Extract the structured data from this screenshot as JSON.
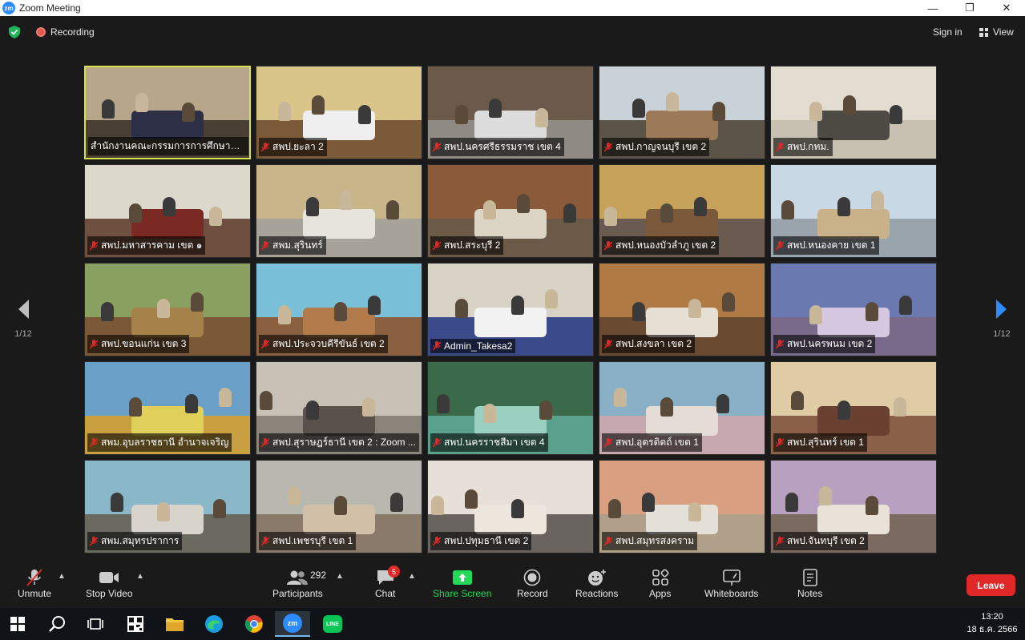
{
  "window": {
    "title": "Zoom Meeting",
    "logo_text": "zm",
    "minimize": "—",
    "restore": "❐",
    "close": "✕"
  },
  "top": {
    "recording_label": "Recording",
    "signin_label": "Sign in",
    "view_label": "View"
  },
  "pagination": {
    "left_page": "1/12",
    "right_page": "1/12"
  },
  "participants": [
    {
      "name": "สำนักงานคณะกรรมการการศึกษาขั้นพื้...",
      "muted": false,
      "active": true,
      "wall": "#b7a68a",
      "floor": "#4a3f35",
      "table": "#2c2f45"
    },
    {
      "name": "สพป.ยะลา 2",
      "muted": true,
      "wall": "#d9c58a",
      "floor": "#7b5a3a",
      "table": "#efefef"
    },
    {
      "name": "สพป.นครศรีธรรมราช เขต 4",
      "muted": true,
      "wall": "#6b5a4a",
      "floor": "#8f8a84",
      "table": "#dcdcdc"
    },
    {
      "name": "สพป.กาญจนบุรี เขต 2",
      "muted": true,
      "wall": "#c9d2d8",
      "floor": "#5c5448",
      "table": "#9c7a58"
    },
    {
      "name": "สพป.กทม.",
      "muted": true,
      "wall": "#e2ddd0",
      "floor": "#c8c0b0",
      "table": "#4e4a44"
    },
    {
      "name": "สพป.มหาสารคาม เขต ๑",
      "muted": true,
      "wall": "#dcd8cc",
      "floor": "#6f5040",
      "table": "#7a2a22"
    },
    {
      "name": "สพม.สุรินทร์",
      "muted": true,
      "wall": "#c8b68a",
      "floor": "#a7a29a",
      "table": "#e7e4de"
    },
    {
      "name": "สพป.สระบุรี 2",
      "muted": true,
      "wall": "#8b5a3a",
      "floor": "#6c5a48",
      "table": "#dcd4c4"
    },
    {
      "name": "สพป.หนองบัวลำภู เขต 2",
      "muted": true,
      "wall": "#c7a25a",
      "floor": "#6a5a50",
      "table": "#7a5a3a"
    },
    {
      "name": "สพป.หนองคาย เขต 1",
      "muted": true,
      "wall": "#c8d8e4",
      "floor": "#9aa4ad",
      "table": "#c9b18a"
    },
    {
      "name": "สพป.ขอนแก่น เขต 3",
      "muted": true,
      "wall": "#8aa060",
      "floor": "#7a5838",
      "table": "#a4824a"
    },
    {
      "name": "สพป.ประจวบคีรีขันธ์ เขต 2",
      "muted": true,
      "wall": "#7ac0d8",
      "floor": "#8a6040",
      "table": "#b07a4a"
    },
    {
      "name": "Admin_Takesa2",
      "muted": true,
      "wall": "#d8d2c4",
      "floor": "#3a4a8a",
      "table": "#f2f2f2"
    },
    {
      "name": "สพป.สงขลา เขต 2",
      "muted": true,
      "wall": "#b07a44",
      "floor": "#6a4a30",
      "table": "#e6e0d4"
    },
    {
      "name": "สพป.นครพนม เขต 2",
      "muted": true,
      "wall": "#6a7ab0",
      "floor": "#7a6a8a",
      "table": "#d6c8e0"
    },
    {
      "name": "สพม.อุบลราชธานี อำนาจเจริญ",
      "muted": true,
      "wall": "#6aa0c8",
      "floor": "#c8a040",
      "table": "#e0d05a"
    },
    {
      "name": "สพป.สุราษฎร์ธานี เขต 2 : Zoom ...",
      "muted": true,
      "wall": "#c8c2b6",
      "floor": "#8a847a",
      "table": "#5a524a"
    },
    {
      "name": "สพป.นครราชสีมา เขต 4",
      "muted": true,
      "wall": "#3a6a4a",
      "floor": "#5aa08a",
      "table": "#9ad0c0"
    },
    {
      "name": "สพป.อุตรดิตถ์ เขต 1",
      "muted": true,
      "wall": "#8ab0c8",
      "floor": "#c8a8b0",
      "table": "#e4dcd4"
    },
    {
      "name": "สพป.สุรินทร์ เขต 1",
      "muted": true,
      "wall": "#e0cca4",
      "floor": "#8a6048",
      "table": "#6a4030"
    },
    {
      "name": "สพม.สมุทรปราการ",
      "muted": true,
      "wall": "#8ab8c8",
      "floor": "#6a6a60",
      "table": "#d8d4cc"
    },
    {
      "name": "สพป.เพชรบุรี เขต 1",
      "muted": true,
      "wall": "#b8b8b0",
      "floor": "#8a7a6a",
      "table": "#d0c0a8"
    },
    {
      "name": "สพป.ปทุมธานี เขต 2",
      "muted": true,
      "wall": "#e6e0d8",
      "floor": "#6a6460",
      "table": "#ece6dc"
    },
    {
      "name": "สพป.สมุทรสงคราม",
      "muted": true,
      "wall": "#d8a080",
      "floor": "#b0a08a",
      "table": "#e4e0d8"
    },
    {
      "name": "สพป.จันทบุรี เขต 2",
      "muted": true,
      "wall": "#b8a0c0",
      "floor": "#7a6a60",
      "table": "#e8e2d8"
    }
  ],
  "toolbar": {
    "unmute": "Unmute",
    "stop_video": "Stop Video",
    "participants": "Participants",
    "participant_count": "292",
    "chat": "Chat",
    "chat_badge": "5",
    "share_screen": "Share Screen",
    "record": "Record",
    "reactions": "Reactions",
    "apps": "Apps",
    "whiteboards": "Whiteboards",
    "notes": "Notes",
    "leave": "Leave",
    "share_color": "#23d959",
    "leave_color": "#e02828"
  },
  "taskbar": {
    "time": "13:20",
    "date": "18 ธ.ค. 2566",
    "items": [
      "windows-start-icon",
      "search-icon",
      "task-view-icon",
      "qr-app-icon",
      "file-explorer-icon",
      "edge-icon",
      "chrome-icon",
      "zoom-icon",
      "line-icon"
    ],
    "zoom_label": "zm",
    "line_label": "LINE"
  }
}
